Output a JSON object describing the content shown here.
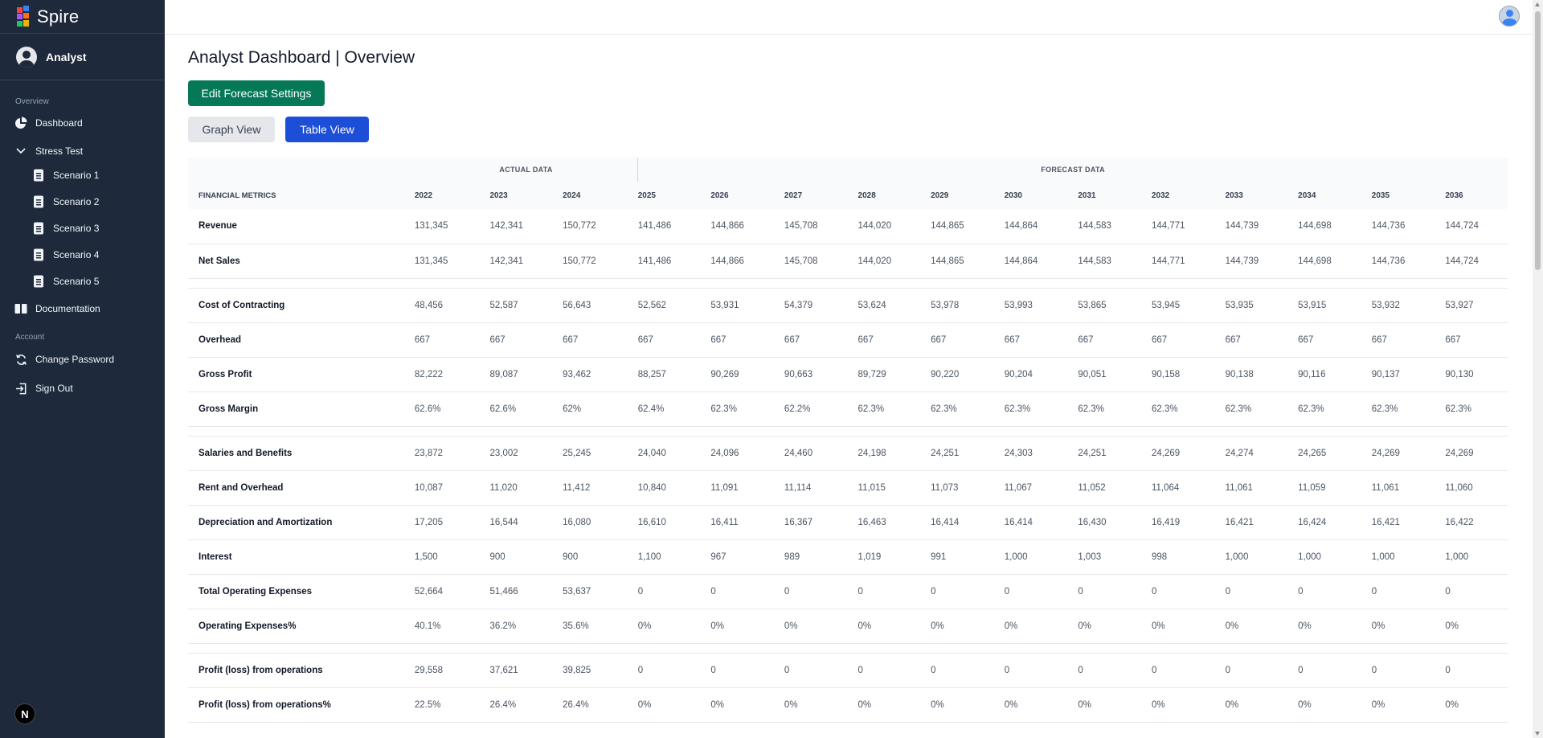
{
  "app": {
    "name": "Spire"
  },
  "user": {
    "name": "Analyst"
  },
  "sidebar": {
    "overview_label": "Overview",
    "dashboard": "Dashboard",
    "stress_test": "Stress Test",
    "scenarios": [
      "Scenario 1",
      "Scenario 2",
      "Scenario 3",
      "Scenario 4",
      "Scenario 5"
    ],
    "documentation": "Documentation",
    "account_label": "Account",
    "change_password": "Change Password",
    "sign_out": "Sign Out"
  },
  "badge": "N",
  "page": {
    "title": "Analyst Dashboard | Overview"
  },
  "buttons": {
    "edit_forecast": "Edit Forecast Settings",
    "graph_view": "Graph View",
    "table_view": "Table View"
  },
  "table": {
    "actual_label": "ACTUAL DATA",
    "forecast_label": "FORECAST DATA",
    "metric_header": "FINANCIAL METRICS",
    "years": [
      "2022",
      "2023",
      "2024",
      "2025",
      "2026",
      "2027",
      "2028",
      "2029",
      "2030",
      "2031",
      "2032",
      "2033",
      "2034",
      "2035",
      "2036"
    ],
    "groups": [
      [
        {
          "label": "Revenue",
          "values": [
            "131,345",
            "142,341",
            "150,772",
            "141,486",
            "144,866",
            "145,708",
            "144,020",
            "144,865",
            "144,864",
            "144,583",
            "144,771",
            "144,739",
            "144,698",
            "144,736",
            "144,724"
          ]
        },
        {
          "label": "Net Sales",
          "values": [
            "131,345",
            "142,341",
            "150,772",
            "141,486",
            "144,866",
            "145,708",
            "144,020",
            "144,865",
            "144,864",
            "144,583",
            "144,771",
            "144,739",
            "144,698",
            "144,736",
            "144,724"
          ]
        }
      ],
      [
        {
          "label": "Cost of Contracting",
          "values": [
            "48,456",
            "52,587",
            "56,643",
            "52,562",
            "53,931",
            "54,379",
            "53,624",
            "53,978",
            "53,993",
            "53,865",
            "53,945",
            "53,935",
            "53,915",
            "53,932",
            "53,927"
          ]
        },
        {
          "label": "Overhead",
          "values": [
            "667",
            "667",
            "667",
            "667",
            "667",
            "667",
            "667",
            "667",
            "667",
            "667",
            "667",
            "667",
            "667",
            "667",
            "667"
          ]
        },
        {
          "label": "Gross Profit",
          "values": [
            "82,222",
            "89,087",
            "93,462",
            "88,257",
            "90,269",
            "90,663",
            "89,729",
            "90,220",
            "90,204",
            "90,051",
            "90,158",
            "90,138",
            "90,116",
            "90,137",
            "90,130"
          ]
        },
        {
          "label": "Gross Margin",
          "values": [
            "62.6%",
            "62.6%",
            "62%",
            "62.4%",
            "62.3%",
            "62.2%",
            "62.3%",
            "62.3%",
            "62.3%",
            "62.3%",
            "62.3%",
            "62.3%",
            "62.3%",
            "62.3%",
            "62.3%"
          ]
        }
      ],
      [
        {
          "label": "Salaries and Benefits",
          "values": [
            "23,872",
            "23,002",
            "25,245",
            "24,040",
            "24,096",
            "24,460",
            "24,198",
            "24,251",
            "24,303",
            "24,251",
            "24,269",
            "24,274",
            "24,265",
            "24,269",
            "24,269"
          ]
        },
        {
          "label": "Rent and Overhead",
          "values": [
            "10,087",
            "11,020",
            "11,412",
            "10,840",
            "11,091",
            "11,114",
            "11,015",
            "11,073",
            "11,067",
            "11,052",
            "11,064",
            "11,061",
            "11,059",
            "11,061",
            "11,060"
          ]
        },
        {
          "label": "Depreciation and Amortization",
          "values": [
            "17,205",
            "16,544",
            "16,080",
            "16,610",
            "16,411",
            "16,367",
            "16,463",
            "16,414",
            "16,414",
            "16,430",
            "16,419",
            "16,421",
            "16,424",
            "16,421",
            "16,422"
          ]
        },
        {
          "label": "Interest",
          "values": [
            "1,500",
            "900",
            "900",
            "1,100",
            "967",
            "989",
            "1,019",
            "991",
            "1,000",
            "1,003",
            "998",
            "1,000",
            "1,000",
            "1,000",
            "1,000"
          ]
        },
        {
          "label": "Total Operating Expenses",
          "values": [
            "52,664",
            "51,466",
            "53,637",
            "0",
            "0",
            "0",
            "0",
            "0",
            "0",
            "0",
            "0",
            "0",
            "0",
            "0",
            "0"
          ]
        },
        {
          "label": "Operating Expenses%",
          "values": [
            "40.1%",
            "36.2%",
            "35.6%",
            "0%",
            "0%",
            "0%",
            "0%",
            "0%",
            "0%",
            "0%",
            "0%",
            "0%",
            "0%",
            "0%",
            "0%"
          ]
        }
      ],
      [
        {
          "label": "Profit (loss) from operations",
          "values": [
            "29,558",
            "37,621",
            "39,825",
            "0",
            "0",
            "0",
            "0",
            "0",
            "0",
            "0",
            "0",
            "0",
            "0",
            "0",
            "0"
          ]
        },
        {
          "label": "Profit (loss) from operations%",
          "values": [
            "22.5%",
            "26.4%",
            "26.4%",
            "0%",
            "0%",
            "0%",
            "0%",
            "0%",
            "0%",
            "0%",
            "0%",
            "0%",
            "0%",
            "0%",
            "0%"
          ]
        }
      ]
    ]
  }
}
